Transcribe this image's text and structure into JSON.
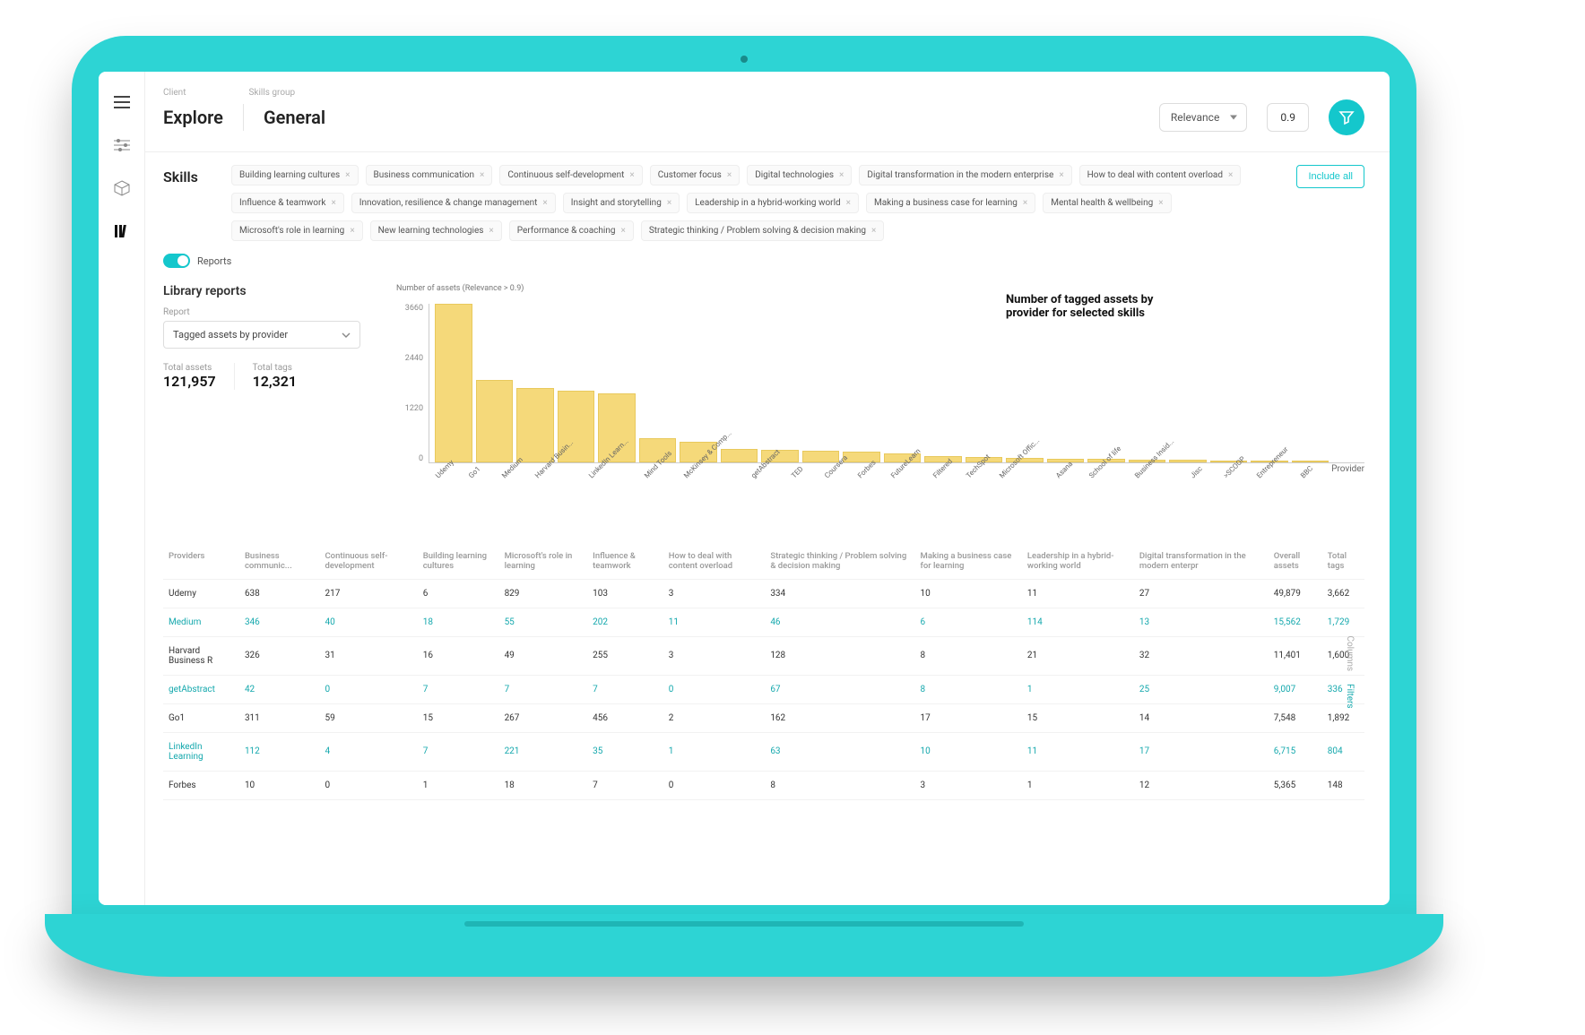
{
  "breadcrumb": {
    "client_label": "Client",
    "group_label": "Skills group"
  },
  "header": {
    "client": "Explore",
    "group": "General",
    "relevance_label": "Relevance",
    "relevance_value": "0.9"
  },
  "skills": {
    "label": "Skills",
    "include_label": "Include all",
    "chips": [
      "Building learning cultures",
      "Business communication",
      "Continuous self-development",
      "Customer focus",
      "Digital technologies",
      "Digital transformation in the modern enterprise",
      "How to deal with content overload",
      "Influence & teamwork",
      "Innovation, resilience & change management",
      "Insight and storytelling",
      "Leadership in a hybrid-working world",
      "Making a business case for learning",
      "Mental health & wellbeing",
      "Microsoft's role in learning",
      "New learning technologies",
      "Performance & coaching",
      "Strategic thinking / Problem solving & decision making"
    ]
  },
  "reports_toggle": "Reports",
  "library": {
    "title": "Library reports",
    "report_label": "Report",
    "report_selected": "Tagged assets by provider",
    "total_assets_label": "Total assets",
    "total_assets": "121,957",
    "total_tags_label": "Total tags",
    "total_tags": "12,321"
  },
  "chart_data": {
    "type": "bar",
    "title": "Number of tagged assets by provider for selected skills",
    "ylabel": "Number of assets (Relevance > 0.9)",
    "xlabel": "Provider",
    "ylim": [
      0,
      3660
    ],
    "yticks": [
      3660,
      2440,
      1220,
      0
    ],
    "categories": [
      "Udemy",
      "Go1",
      "Medium",
      "Harvard Busin...",
      "LinkedIn Learn...",
      "Mind Tools",
      "McKinsey & Comp...",
      "getAbstract",
      "TED",
      "Coursera",
      "Forbes",
      "FutureLearn",
      "Filtered",
      "TechSpot",
      "Microsoft Offic...",
      "Asana",
      "School of life",
      "Business Insid...",
      "Jisc",
      ">SCOOP",
      "Entrepreneur",
      "BBC"
    ],
    "values": [
      3660,
      1900,
      1720,
      1650,
      1600,
      550,
      480,
      320,
      300,
      260,
      240,
      200,
      150,
      120,
      100,
      90,
      80,
      70,
      60,
      50,
      45,
      40
    ]
  },
  "table": {
    "headers": [
      "Providers",
      "Business communic...",
      "Continuous self-development",
      "Building learning cultures",
      "Microsoft's role in learning",
      "Influence & teamwork",
      "How to deal with content overload",
      "Strategic thinking / Problem solving & decision making",
      "Making a business case for learning",
      "Leadership in a hybrid-working world",
      "Digital transformation in the modern enterpr",
      "Overall assets",
      "Total tags"
    ],
    "rows": [
      [
        "Udemy",
        "638",
        "217",
        "6",
        "829",
        "103",
        "3",
        "334",
        "10",
        "11",
        "27",
        "49,879",
        "3,662"
      ],
      [
        "Medium",
        "346",
        "40",
        "18",
        "55",
        "202",
        "11",
        "46",
        "6",
        "114",
        "13",
        "15,562",
        "1,729"
      ],
      [
        "Harvard Business R",
        "326",
        "31",
        "16",
        "49",
        "255",
        "3",
        "128",
        "8",
        "21",
        "32",
        "11,401",
        "1,600"
      ],
      [
        "getAbstract",
        "42",
        "0",
        "7",
        "7",
        "7",
        "0",
        "67",
        "8",
        "1",
        "25",
        "9,007",
        "336"
      ],
      [
        "Go1",
        "311",
        "59",
        "15",
        "267",
        "456",
        "2",
        "162",
        "17",
        "15",
        "14",
        "7,548",
        "1,892"
      ],
      [
        "LinkedIn Learning",
        "112",
        "4",
        "7",
        "221",
        "35",
        "1",
        "63",
        "10",
        "11",
        "17",
        "6,715",
        "804"
      ],
      [
        "Forbes",
        "10",
        "0",
        "1",
        "18",
        "7",
        "0",
        "8",
        "3",
        "1",
        "12",
        "5,365",
        "148"
      ]
    ],
    "side_tabs": {
      "columns": "Columns",
      "filters": "Filters"
    }
  }
}
